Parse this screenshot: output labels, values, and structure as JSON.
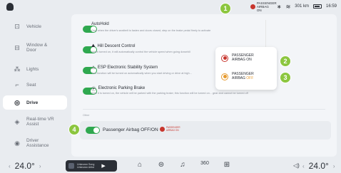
{
  "status_bar": {
    "airbag_status": "PASSENGER AIRBAG ON",
    "range": "301 km",
    "time": "16:59",
    "icons": [
      "bluetooth-icon",
      "wifi-icon",
      "battery-icon"
    ]
  },
  "sidebar": {
    "items": [
      {
        "label": "Vehicle",
        "icon": "car-icon"
      },
      {
        "label": "Window & Door",
        "icon": "window-icon"
      },
      {
        "label": "Lights",
        "icon": "light-icon"
      },
      {
        "label": "Seat",
        "icon": "seat-icon"
      },
      {
        "label": "Drive",
        "icon": "steering-icon",
        "active": true
      },
      {
        "label": "Real-time VR Assist",
        "icon": "vr-icon"
      },
      {
        "label": "Driver Assistance",
        "icon": "assist-icon"
      }
    ]
  },
  "settings": {
    "autohold": {
      "title": "AutoHold",
      "desc": "Only when the driver's seatbelt is fasten and doors closed, step on the brake pedal firmly to activate"
    },
    "hdc": {
      "title": "Hill Descent Control",
      "desc": "When turned on, it will automatically control the vehicle speed when going downhill"
    },
    "esp": {
      "title": "ESP Electronic Stability System",
      "desc": "This function will be turned on automatically when you start driving or drive at high..."
    },
    "epb": {
      "title": "Electronic Parking Brake",
      "desc": "After it is turned on, the vehicle will be parked with the parking brake; this function will be turned on... gear and cannot be turned off"
    },
    "section_other": "Other",
    "passenger_airbag": {
      "title": "Passenger Airbag OFF/ON",
      "badge_line1": "PASSENGER",
      "badge_line2": "AIRBAG ON"
    }
  },
  "popup": {
    "item_on": {
      "line1": "PASSENGER",
      "line2": "AIRBAG ON"
    },
    "item_off": {
      "line1": "PASSENGER",
      "line2_prefix": "AIRBAG ",
      "line2_off": "OFF"
    }
  },
  "callouts": [
    "1",
    "2",
    "3",
    "4"
  ],
  "bottom_bar": {
    "temp_left": "24.0°",
    "temp_right": "24.0°",
    "song_title": "Unknown Song",
    "song_artist": "Unknown Artist",
    "dock_icons": [
      "home-icon",
      "car-icon",
      "music-icon",
      "360-icon",
      "apps-icon"
    ],
    "dock_360": "360"
  },
  "colors": {
    "accent_green": "#2fa84f",
    "callout_green": "#8cc63f",
    "airbag_red": "#c8362e",
    "airbag_orange": "#e69a2e"
  }
}
